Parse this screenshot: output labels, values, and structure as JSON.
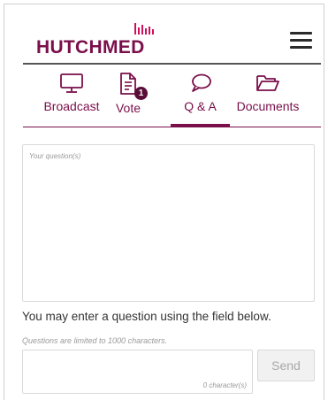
{
  "header": {
    "logo_text": "HUTCHMED"
  },
  "tabs": [
    {
      "label": "Broadcast",
      "icon": "monitor-icon"
    },
    {
      "label": "Vote",
      "icon": "document-icon",
      "badge": "1"
    },
    {
      "label": "Q & A",
      "icon": "speech-bubble-icon",
      "active": true
    },
    {
      "label": "Documents",
      "icon": "folder-open-icon"
    }
  ],
  "qa": {
    "question_placeholder": "Your question(s)",
    "instruction": "You may enter a question using the field below.",
    "limit_note": "Questions are limited to 1000  characters.",
    "char_count": "0 character(s)",
    "send_label": "Send"
  },
  "colors": {
    "brand": "#7a0f4a",
    "badge": "#5a0d37"
  }
}
